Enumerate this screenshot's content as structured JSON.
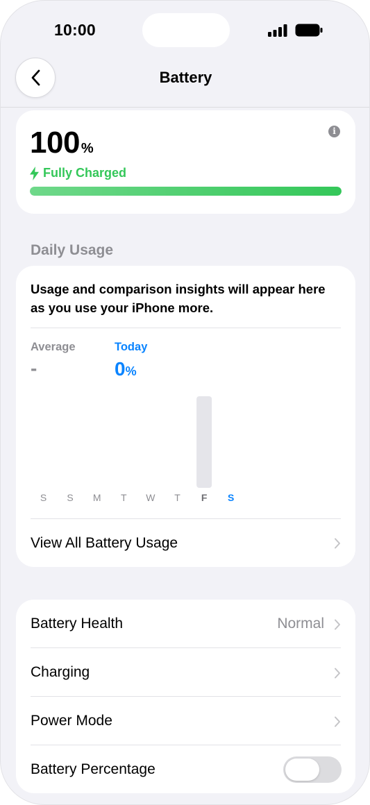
{
  "status_bar": {
    "time": "10:00",
    "signal_icon": "cellular-signal-icon",
    "battery_icon": "battery-full-icon"
  },
  "nav": {
    "back_icon": "chevron-left-icon",
    "title": "Battery"
  },
  "battery": {
    "level_number": "100",
    "level_unit": "%",
    "status": "Fully Charged",
    "status_icon": "lightning-bolt-icon",
    "charge_fraction": 1.0,
    "info_icon": "info-icon",
    "accent_color": "#34c759"
  },
  "daily_usage": {
    "header": "Daily Usage",
    "note": "Usage and comparison insights will appear here as you use your iPhone more.",
    "average_label": "Average",
    "average_value": "-",
    "today_label": "Today",
    "today_value_number": "0",
    "today_value_unit": "%",
    "today_color": "#0a84ff",
    "view_all_label": "View All Battery Usage"
  },
  "chart_data": {
    "type": "bar",
    "categories": [
      "S",
      "S",
      "M",
      "T",
      "W",
      "T",
      "F",
      "S"
    ],
    "values": [
      null,
      null,
      null,
      null,
      null,
      null,
      1.0,
      0
    ],
    "highlight_index": 7,
    "ylim": [
      0,
      1
    ],
    "grid": false,
    "bar_color": "#e5e5ea",
    "label_color": "#8e8e93",
    "highlight_color": "#0a84ff"
  },
  "settings": {
    "battery_health_label": "Battery Health",
    "battery_health_value": "Normal",
    "charging_label": "Charging",
    "power_mode_label": "Power Mode",
    "battery_percentage_label": "Battery Percentage",
    "battery_percentage_on": false
  }
}
